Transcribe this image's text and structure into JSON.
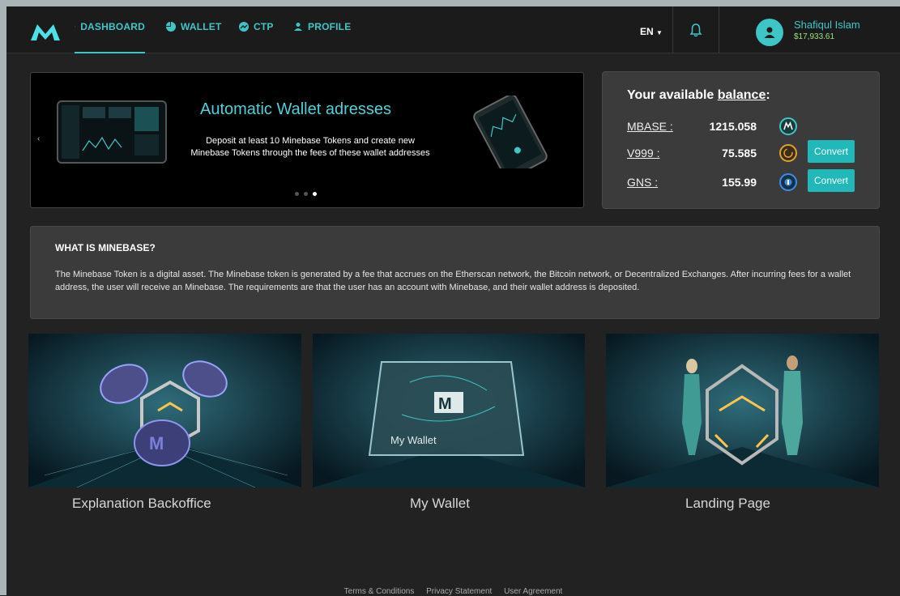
{
  "nav": {
    "items": [
      {
        "label": "DASHBOARD",
        "icon": "list-icon",
        "active": true
      },
      {
        "label": "WALLET",
        "icon": "pie-chart-icon"
      },
      {
        "label": "CTP",
        "icon": "trend-icon"
      },
      {
        "label": "PROFILE",
        "icon": "user-icon"
      }
    ],
    "language": "EN",
    "user": {
      "name": "Shafiqul Islam",
      "balance": "$17,933.61"
    }
  },
  "carousel": {
    "title": "Automatic Wallet adresses",
    "text_line1": "Deposit at least 10 Minebase Tokens and create new",
    "text_line2": "Minebase Tokens through the fees of these wallet addresses",
    "slide_count": 3,
    "active_slide": 3
  },
  "balance": {
    "title_prefix": "Your available ",
    "title_link": "balance",
    "title_suffix": ":",
    "rows": [
      {
        "label": "MBASE :",
        "value": "1215.058",
        "icon": "mbase-coin-icon",
        "color": "#3ec6c6"
      },
      {
        "label": "V999 :",
        "value": "75.585",
        "icon": "v999-coin-icon",
        "color": "#e0a030",
        "button": "Convert"
      },
      {
        "label": "GNS :",
        "value": "155.99",
        "icon": "gns-coin-icon",
        "color": "#3b8fe0",
        "button": "Convert"
      }
    ]
  },
  "about": {
    "title": "WHAT IS MINEBASE?",
    "text": "The Minebase Token is a digital asset. The Minebase token is generated by a fee that accrues on the Etherscan network, the Bitcoin network, or Decentralized Exchanges. After incurring fees for a wallet address, the user will receive an Minebase. The requirements are that the user has an account with Minebase, and their wallet address is deposited."
  },
  "cards": [
    {
      "caption": "Explanation Backoffice"
    },
    {
      "caption": "My Wallet",
      "art_text": "My Wallet"
    },
    {
      "caption": "Landing Page"
    }
  ],
  "footer": {
    "links": [
      "Terms & Conditions",
      "Privacy Statement",
      "User Agreement"
    ]
  },
  "colors": {
    "accent": "#3ec6c6",
    "button": "#20b8b8",
    "panel": "#3b3b3b",
    "background": "#222222"
  }
}
